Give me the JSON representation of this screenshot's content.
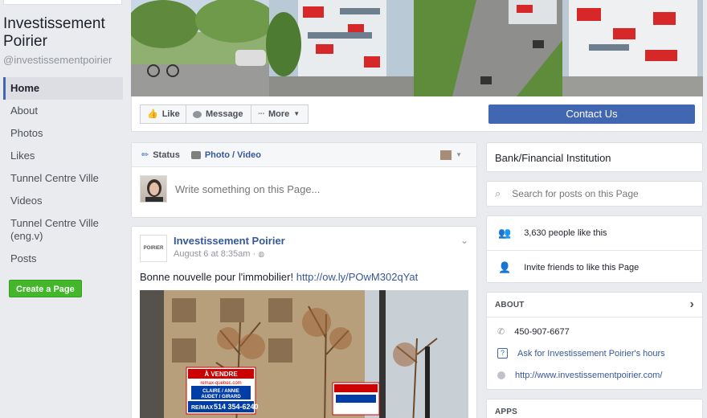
{
  "sidebar": {
    "page_name": "Investissement Poirier",
    "handle": "@investissementpoirier",
    "nav": [
      "Home",
      "About",
      "Photos",
      "Likes",
      "Tunnel Centre Ville",
      "Videos",
      "Tunnel Centre Ville (eng.v)",
      "Posts"
    ],
    "create_page": "Create a Page"
  },
  "action_bar": {
    "like": "Like",
    "message": "Message",
    "more": "More",
    "contact": "Contact Us"
  },
  "composer": {
    "tab_status": "Status",
    "tab_photo": "Photo / Video",
    "placeholder": "Write something on this Page..."
  },
  "post": {
    "logo_text": "POIRIER",
    "author": "Investissement Poirier",
    "date": "August 6 at 8:35am ·",
    "text": "Bonne nouvelle pour l'immobilier!",
    "link": "http://ow.ly/POwM302qYat",
    "sign1": {
      "l1": "À VENDRE",
      "l2": "remax-quebec.com",
      "l3": "CLAIRE / ANNIE",
      "l4": "AUDET / GIRARD",
      "l5": "RE/MAX",
      "l6": "514 354-6240"
    }
  },
  "right": {
    "category": "Bank/Financial Institution",
    "search_placeholder": "Search for posts on this Page",
    "likes_count": "3,630 people like this",
    "invite": "Invite friends to like this Page",
    "about_title": "ABOUT",
    "phone": "450-907-6677",
    "hours": "Ask for Investissement Poirier's hours",
    "website": "http://www.investissementpoirier.com/",
    "apps_title": "APPS"
  },
  "colors": {
    "brand": "#4267b2",
    "green": "#42b72a",
    "link": "#365899"
  }
}
